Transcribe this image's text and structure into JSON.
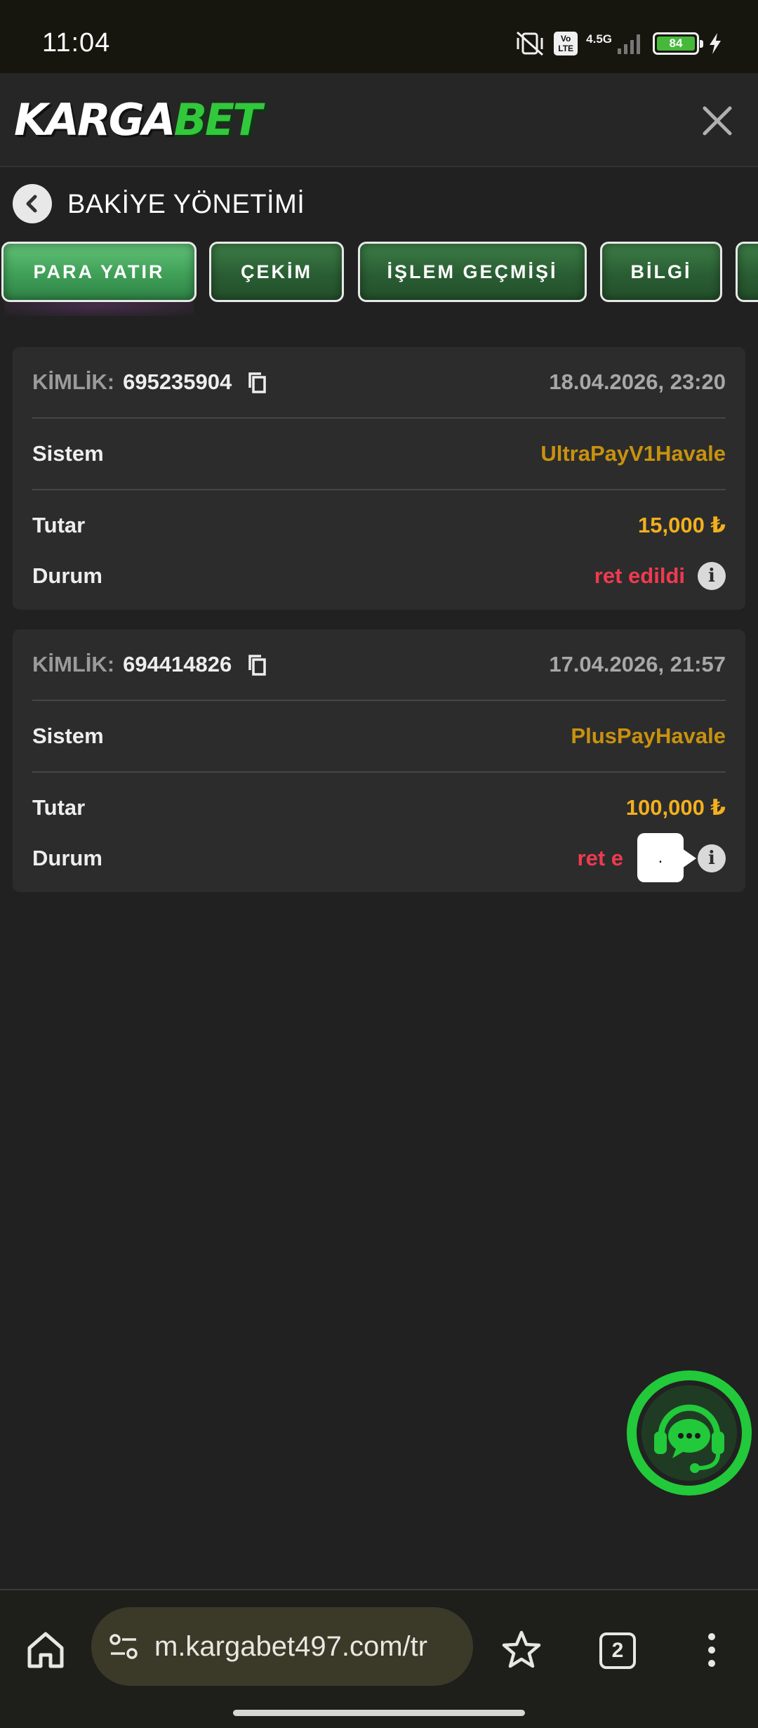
{
  "status_bar": {
    "time": "11:04",
    "network": "4.5G",
    "volte": "Vo LTE",
    "battery": "84"
  },
  "header": {
    "logo_left": "KARGA",
    "logo_right": "BET"
  },
  "title_bar": {
    "title": "BAKİYE YÖNETİMİ"
  },
  "tabs": [
    {
      "label": "PARA YATIR",
      "active": true
    },
    {
      "label": "ÇEKİM",
      "active": false
    },
    {
      "label": "İŞLEM GEÇMİŞİ",
      "active": false
    },
    {
      "label": "BİLGİ",
      "active": false
    }
  ],
  "transactions": [
    {
      "id_label": "KİMLİK:",
      "id": "695235904",
      "date": "18.04.2026, 23:20",
      "system_label": "Sistem",
      "system": "UltraPayV1Havale",
      "amount_label": "Tutar",
      "amount": "15,000 ₺",
      "status_label": "Durum",
      "status": "ret edildi"
    },
    {
      "id_label": "KİMLİK:",
      "id": "694414826",
      "date": "17.04.2026, 21:57",
      "system_label": "Sistem",
      "system": "PlusPayHavale",
      "amount_label": "Tutar",
      "amount": "100,000 ₺",
      "status_label": "Durum",
      "status": "ret e",
      "tooltip": "."
    }
  ],
  "browser": {
    "url": "m.kargabet497.com/tr",
    "tab_count": "2"
  },
  "colors": {
    "accent_green": "#32c83c",
    "status_red": "#f03a50",
    "amount_gold": "#f2b01e",
    "system_gold": "#c8920f"
  }
}
